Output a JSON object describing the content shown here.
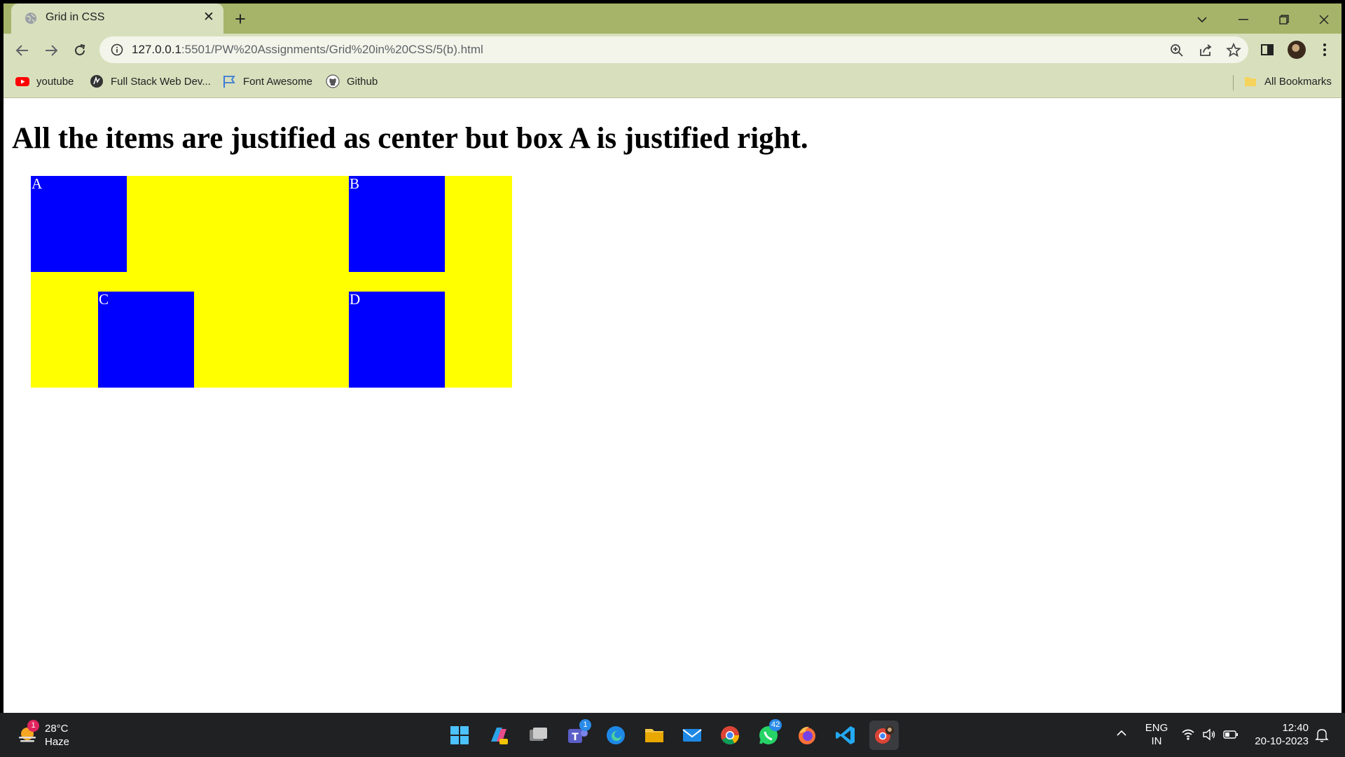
{
  "tab": {
    "title": "Grid in CSS"
  },
  "toolbar": {
    "url_host": "127.0.0.1",
    "url_path": ":5501/PW%20Assignments/Grid%20in%20CSS/5(b).html"
  },
  "bookmarks": {
    "items": [
      {
        "label": "youtube",
        "icon": "youtube-icon"
      },
      {
        "label": "Full Stack Web Dev...",
        "icon": "site-icon"
      },
      {
        "label": "Font Awesome",
        "icon": "flag-icon"
      },
      {
        "label": "Github",
        "icon": "github-icon"
      }
    ],
    "all_bookmarks": "All Bookmarks"
  },
  "page": {
    "heading": "All the items are justified as center but box A is justified right.",
    "boxes": [
      "A",
      "B",
      "C",
      "D"
    ],
    "colors": {
      "container": "#ffff00",
      "box": "#0000ff",
      "box_text": "#ffffff"
    }
  },
  "taskbar": {
    "weather": {
      "temp": "28°C",
      "condition": "Haze",
      "badge": "1"
    },
    "teams_badge": "1",
    "whatsapp_badge": "42",
    "language": {
      "line1": "ENG",
      "line2": "IN"
    },
    "time": "12:40",
    "date": "20-10-2023"
  }
}
